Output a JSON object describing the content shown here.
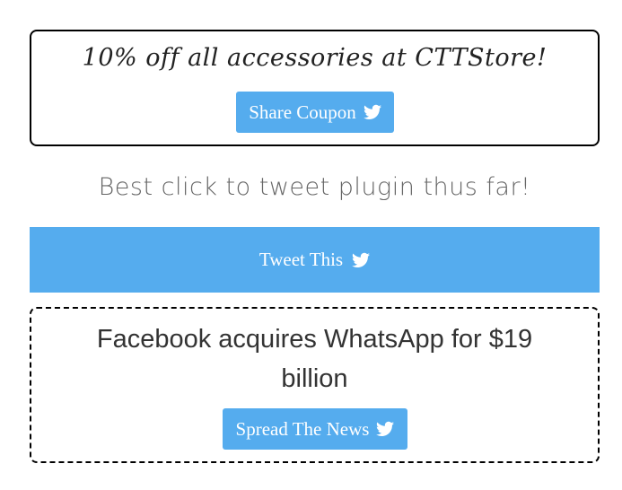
{
  "coupon": {
    "text": "10% off all accessories at CTTStore!",
    "button_label": "Share Coupon",
    "button_icon": "twitter-bird-icon"
  },
  "quote": {
    "text": "Best click to tweet plugin thus far!"
  },
  "tweet_bar": {
    "label": "Tweet This",
    "icon": "twitter-bird-icon"
  },
  "news": {
    "text": "Facebook acquires WhatsApp for $19 billion",
    "button_label": "Spread The News",
    "button_icon": "twitter-bird-icon"
  },
  "colors": {
    "twitter_blue": "#55acee",
    "border": "#000000",
    "text_dark": "#333333",
    "text_muted": "#666666"
  }
}
